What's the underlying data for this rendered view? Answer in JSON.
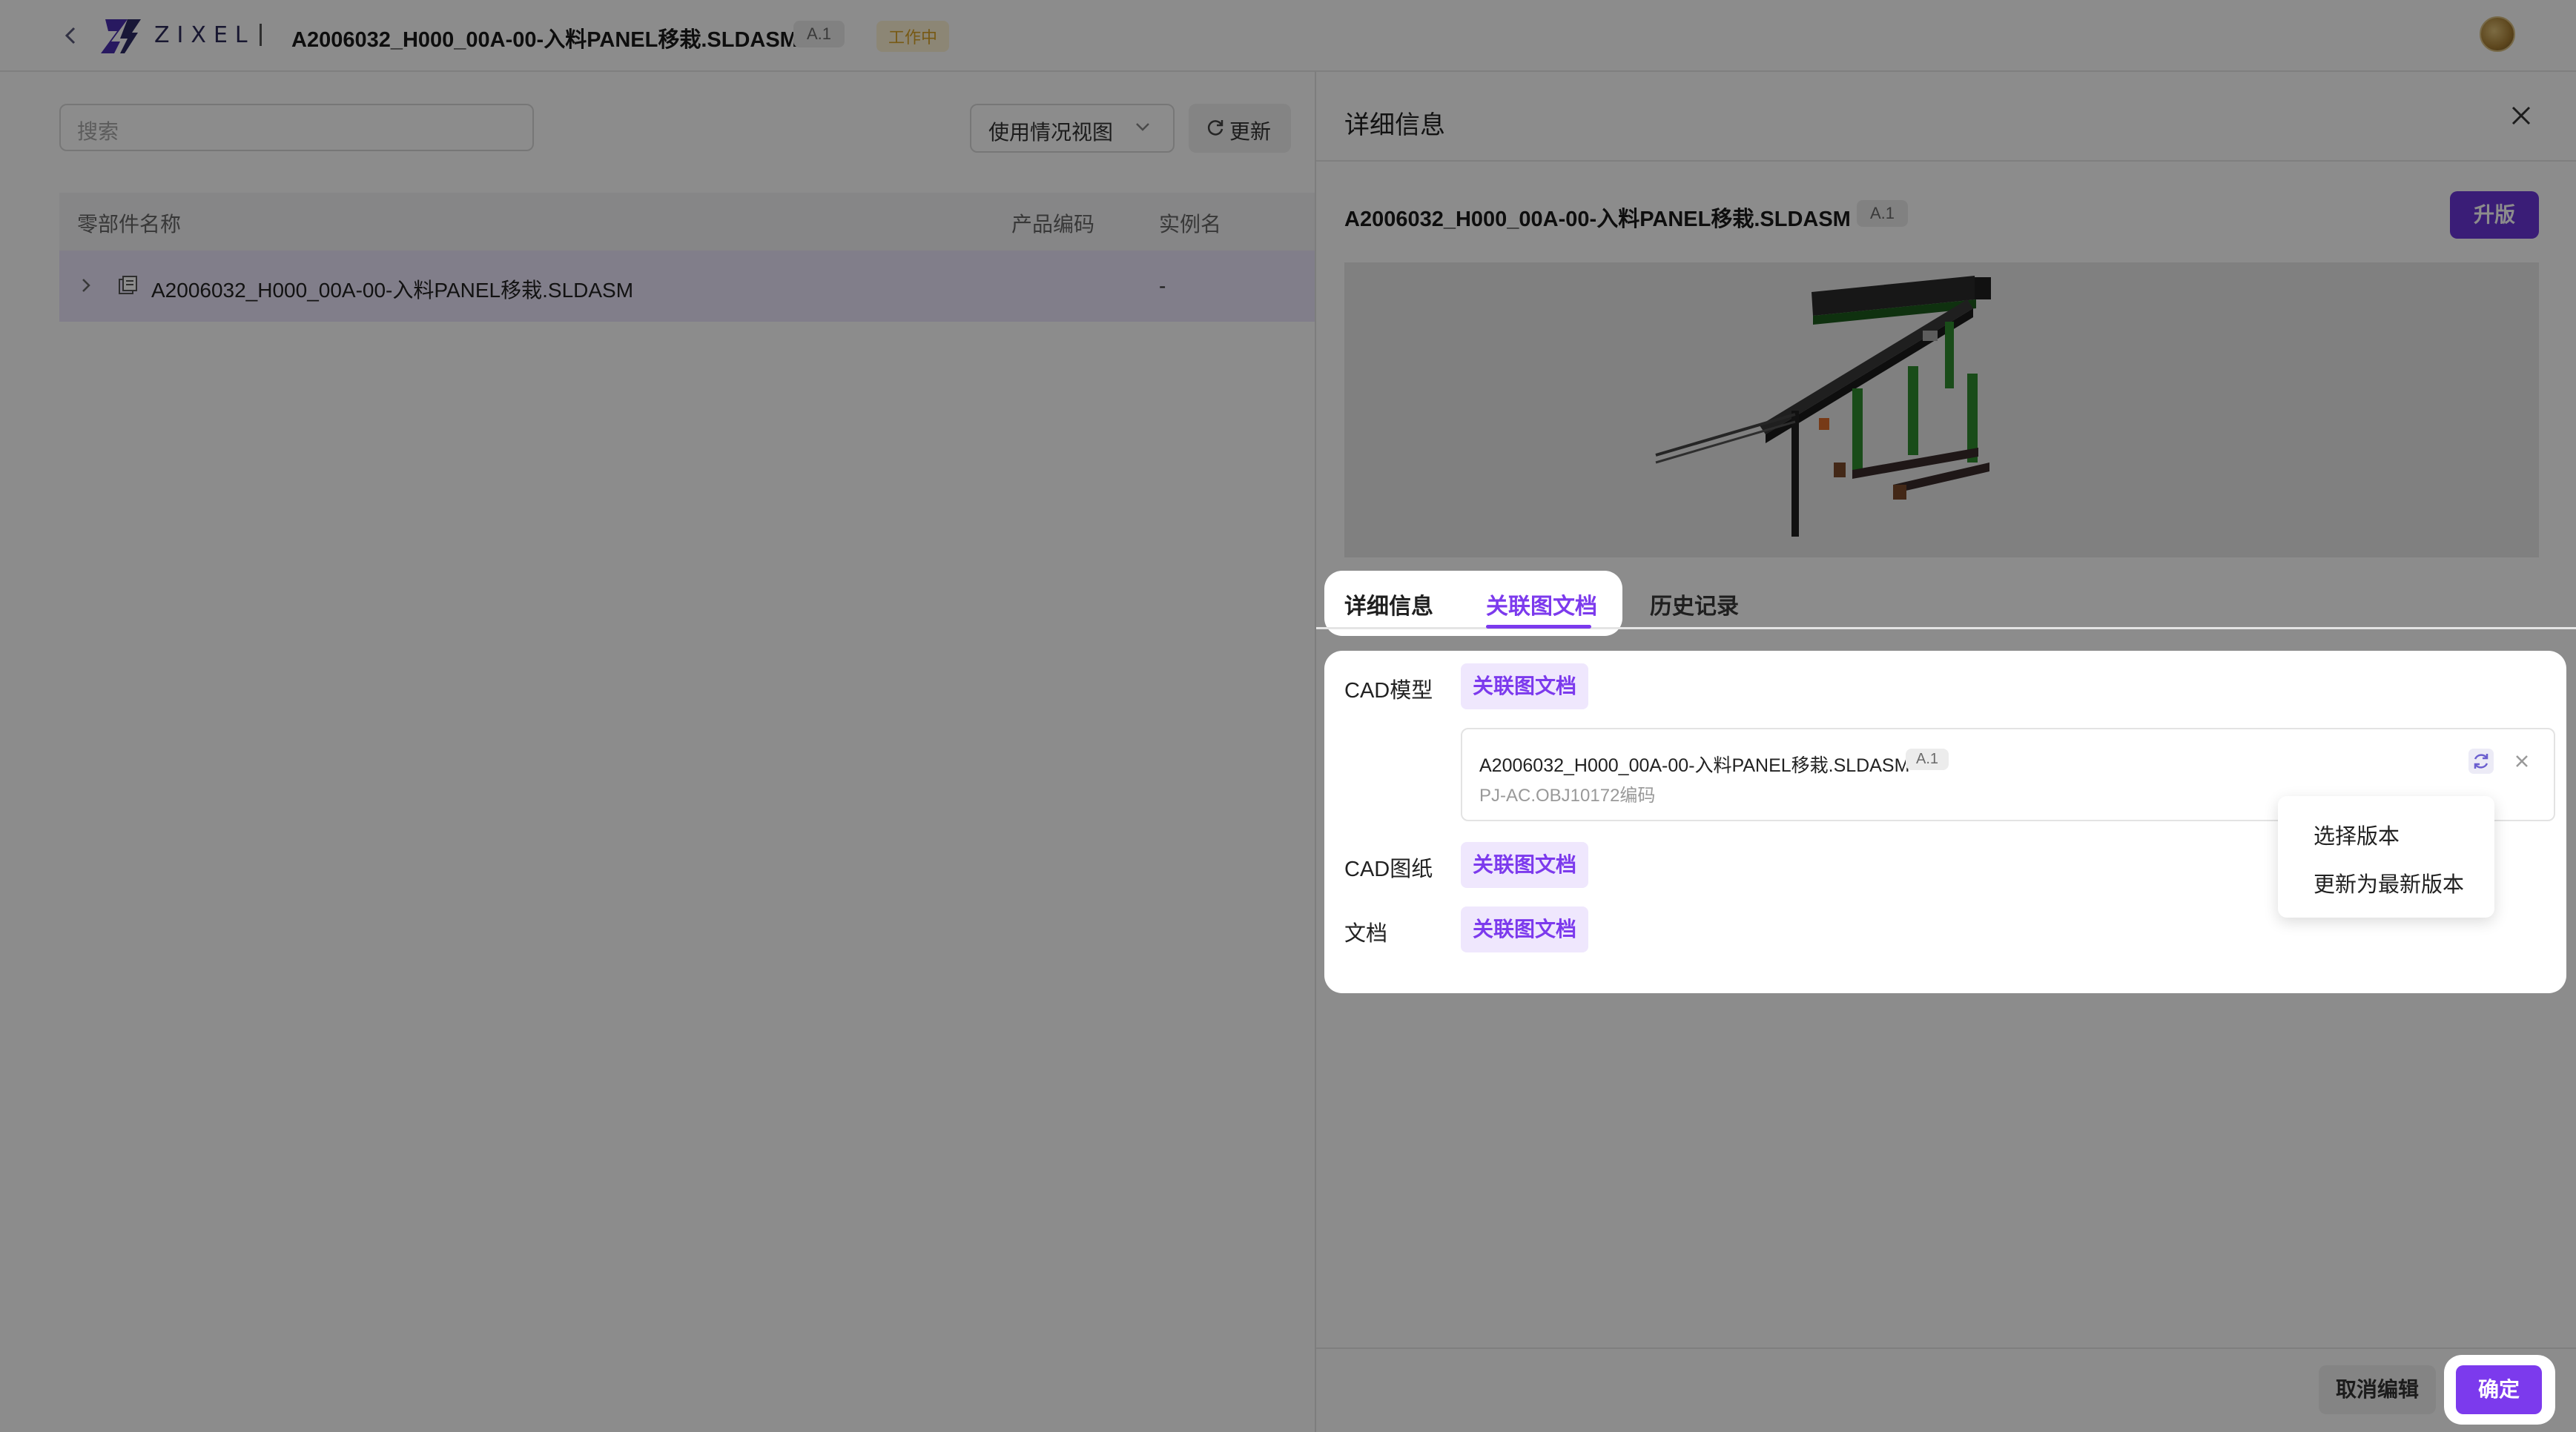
{
  "topbar": {
    "logo_text": "ZIXEL",
    "title": "A2006032_H000_00A-00-入料PANEL移栽.SLDASM",
    "version": "A.1",
    "status": "工作中",
    "status_color": "#d9a326"
  },
  "left": {
    "search_placeholder": "搜索",
    "view_select": "使用情况视图",
    "refresh_label": "更新",
    "table": {
      "columns": [
        "零部件名称",
        "产品编码",
        "实例名"
      ],
      "rows": [
        {
          "name": "A2006032_H000_00A-00-入料PANEL移栽.SLDASM",
          "product_code": "",
          "instance": "-"
        }
      ]
    }
  },
  "panel": {
    "title": "详细信息",
    "item_name": "A2006032_H000_00A-00-入料PANEL移栽.SLDASM",
    "item_version": "A.1",
    "upgrade_label": "升版",
    "tabs": [
      {
        "label": "详细信息",
        "active": false
      },
      {
        "label": "关联图文档",
        "active": true
      },
      {
        "label": "历史记录",
        "active": false
      }
    ],
    "sections": [
      {
        "label": "CAD模型",
        "link": "关联图文档"
      },
      {
        "label": "CAD图纸",
        "link": "关联图文档"
      },
      {
        "label": "文档",
        "link": "关联图文档"
      }
    ],
    "linked_doc": {
      "name": "A2006032_H000_00A-00-入料PANEL移栽.SLDASM",
      "version": "A.1",
      "code": "PJ-AC.OBJ10172编码"
    },
    "dropdown": [
      "选择版本",
      "更新为最新版本"
    ],
    "cancel_label": "取消编辑",
    "confirm_label": "确定"
  },
  "colors": {
    "accent": "#7c3aed",
    "upgrade": "#6b35d9",
    "overlay": "rgba(0,0,0,0.45)"
  },
  "icons": [
    "back-icon",
    "zixel-logo-icon",
    "avatar",
    "chevron-down-icon",
    "refresh-icon",
    "expand-chevron-icon",
    "assembly-icon",
    "close-icon",
    "sync-icon"
  ]
}
